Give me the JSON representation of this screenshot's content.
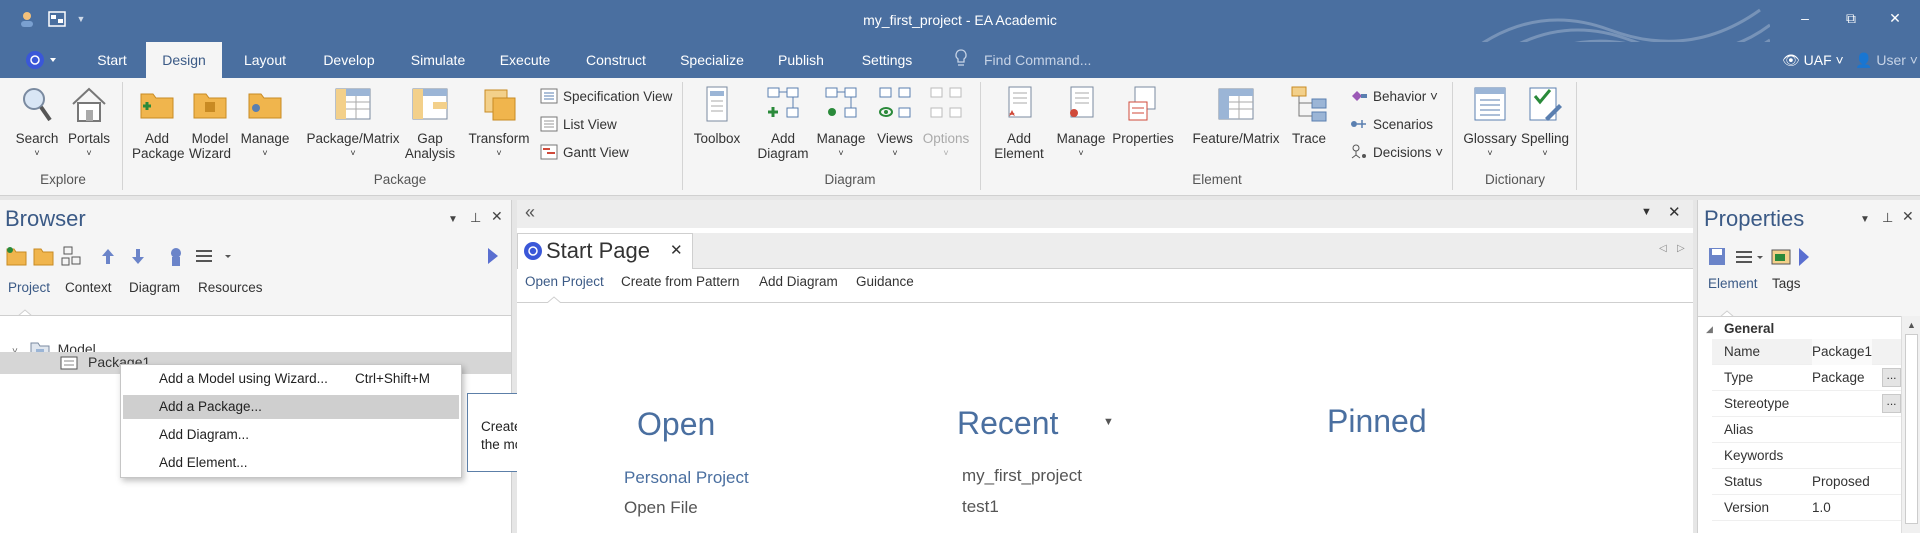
{
  "window": {
    "title": "my_first_project - EA Academic",
    "minimize": "–",
    "restore": "⧉",
    "close": "✕"
  },
  "ribbon_tabs": [
    "Start",
    "Design",
    "Layout",
    "Develop",
    "Simulate",
    "Execute",
    "Construct",
    "Specialize",
    "Publish",
    "Settings"
  ],
  "active_tab": "Design",
  "find_placeholder": "Find Command...",
  "perspective": "UAF",
  "user": "User",
  "ribbon": {
    "explore": {
      "group": "Explore",
      "search": "Search",
      "portals": "Portals"
    },
    "package": {
      "group": "Package",
      "add_package": "Add Package",
      "model_wizard": "Model Wizard",
      "manage": "Manage",
      "package_matrix": "Package/Matrix",
      "gap_analysis": "Gap Analysis",
      "transform": "Transform",
      "specification_view": "Specification View",
      "list_view": "List View",
      "gantt_view": "Gantt View"
    },
    "diagram": {
      "group": "Diagram",
      "toolbox": "Toolbox",
      "add_diagram": "Add Diagram",
      "manage": "Manage",
      "views": "Views",
      "options": "Options"
    },
    "element": {
      "group": "Element",
      "add_element": "Add Element",
      "manage": "Manage",
      "properties": "Properties",
      "feature_matrix": "Feature/Matrix",
      "trace": "Trace",
      "behavior": "Behavior",
      "scenarios": "Scenarios",
      "decisions": "Decisions"
    },
    "dictionary": {
      "group": "Dictionary",
      "glossary": "Glossary",
      "spelling": "Spelling"
    }
  },
  "browser": {
    "title": "Browser",
    "tabs": [
      "Project",
      "Context",
      "Diagram",
      "Resources"
    ],
    "active_tab": "Project",
    "tree": {
      "root": "Model",
      "child": "Package1"
    }
  },
  "context_menu": {
    "items": [
      {
        "label": "Add a Model using Wizard...",
        "shortcut": "Ctrl+Shift+M"
      },
      {
        "label": "Add a Package...",
        "shortcut": ""
      },
      {
        "label": "Add Diagram...",
        "shortcut": ""
      },
      {
        "label": "Add Element...",
        "shortcut": ""
      }
    ],
    "highlighted_index": 1,
    "tooltip": "Create a new package in the model"
  },
  "start_page": {
    "tab_title": "Start Page",
    "subtabs": [
      "Open Project",
      "Create from Pattern",
      "Add Diagram",
      "Guidance"
    ],
    "active_subtab": "Open Project",
    "open_heading": "Open",
    "open_links": [
      "Personal Project",
      "Open File"
    ],
    "recent_heading": "Recent",
    "recent_items": [
      "my_first_project",
      "test1"
    ],
    "pinned_heading": "Pinned"
  },
  "properties": {
    "title": "Properties",
    "tabs": [
      "Element",
      "Tags"
    ],
    "active_tab": "Element",
    "section": "General",
    "rows": [
      {
        "key": "Name",
        "value": "Package1"
      },
      {
        "key": "Type",
        "value": "Package"
      },
      {
        "key": "Stereotype",
        "value": ""
      },
      {
        "key": "Alias",
        "value": ""
      },
      {
        "key": "Keywords",
        "value": ""
      },
      {
        "key": "Status",
        "value": "Proposed"
      },
      {
        "key": "Version",
        "value": "1.0"
      }
    ]
  },
  "colors": {
    "accent": "#4a6fa0",
    "ribbon_bg": "#f5f5f5",
    "highlight": "#cfcfcf"
  }
}
